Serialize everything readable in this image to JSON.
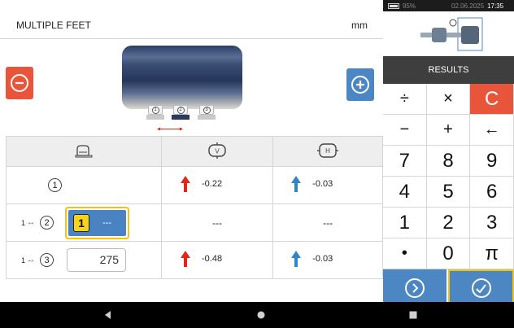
{
  "header": {
    "title": "MULTIPLE FEET",
    "unit": "mm"
  },
  "machine": {
    "feet": [
      "1",
      "2",
      "3"
    ],
    "selected_foot": "2"
  },
  "icons": {
    "minus": "minus-circle-icon",
    "plus": "plus-circle-icon",
    "feet_column": "machine-feet-icon",
    "vertical_column": "vertical-view-icon",
    "horizontal_column": "horizontal-view-icon",
    "up_arrow": "arrow-up-icon"
  },
  "table": {
    "headers": {
      "vertical": "V",
      "horizontal": "H"
    },
    "rows": [
      {
        "foot": "1",
        "pair_from": "",
        "distance": "",
        "vertical": "-0.22",
        "horizontal": "-0.03",
        "vertical_color": "#e0261d",
        "horizontal_color": "#2d86c8"
      },
      {
        "foot": "2",
        "pair_from": "1",
        "badge": "1",
        "distance": "---",
        "vertical": "---",
        "horizontal": "---"
      },
      {
        "foot": "3",
        "pair_from": "1",
        "distance": "275",
        "vertical": "-0.48",
        "horizontal": "-0.03",
        "vertical_color": "#e0261d",
        "horizontal_color": "#2d86c8"
      }
    ]
  },
  "statusbar": {
    "battery": "95%",
    "date": "02.06.2025",
    "time": "17:35"
  },
  "results_label": "RESULTS",
  "keypad": {
    "row1": [
      "÷",
      "×",
      "C"
    ],
    "row2": [
      "−",
      "+",
      "←"
    ],
    "row3": [
      "7",
      "8",
      "9"
    ],
    "row4": [
      "4",
      "5",
      "6"
    ],
    "row5": [
      "1",
      "2",
      "3"
    ],
    "row6": [
      "•",
      "0",
      "π"
    ]
  },
  "colors": {
    "accent_blue": "#4d87c3",
    "accent_red": "#e8553b",
    "highlight_yellow": "#f2c40f"
  }
}
